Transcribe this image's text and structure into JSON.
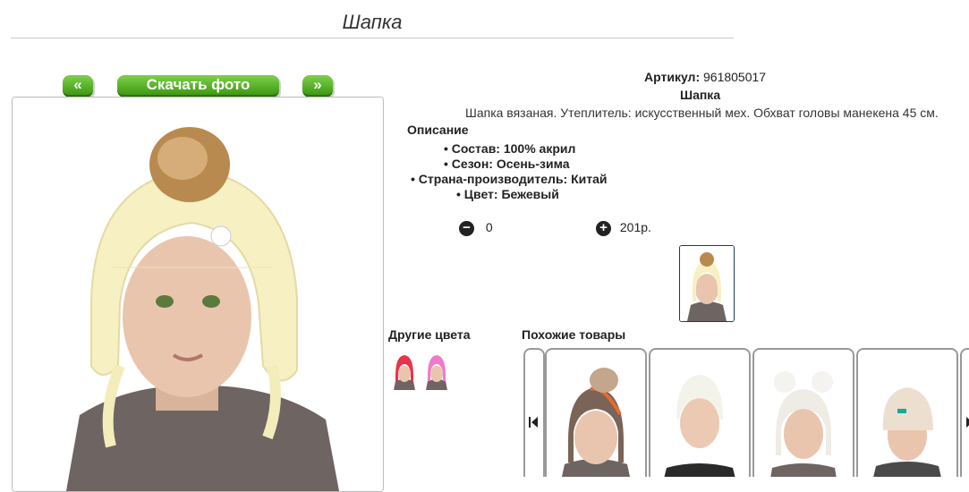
{
  "page": {
    "title": "Шапка",
    "nav": {
      "prev": "«",
      "download": "Скачать фото",
      "next": "»"
    }
  },
  "product": {
    "article_label": "Артикул:",
    "article_value": "961805017",
    "name": "Шапка",
    "description": "Шапка вязаная. Утеплитель: искусственный мех. Обхват головы манекена 45 см.",
    "description_heading": "Описание",
    "properties": [
      "Состав: 100% акрил",
      "Сезон: Осень-зима",
      "Страна-производитель: Китай",
      "Цвет: Бежевый"
    ],
    "quantity": "0",
    "price": "201р."
  },
  "other_colors": {
    "label": "Другие цвета",
    "colors": [
      "#e8334a",
      "#f07ac8"
    ]
  },
  "similar": {
    "label": "Похожие товары"
  },
  "colors": {
    "button_green": "#4caf1f",
    "hat_cream": "#f6f0c2",
    "sweater": "#6e6461"
  }
}
